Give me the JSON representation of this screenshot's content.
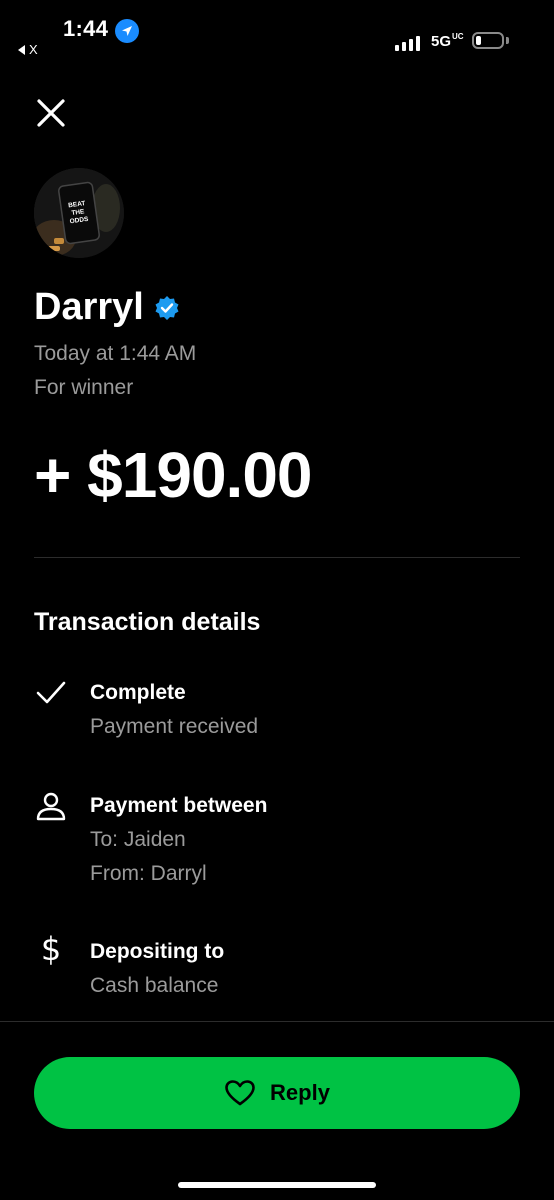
{
  "status_bar": {
    "time": "1:44",
    "back_app": "X",
    "network": "5G",
    "network_suffix": "UC",
    "location_icon": "location-arrow-icon",
    "battery_level": 0.2
  },
  "header": {
    "close_icon": "close-icon"
  },
  "profile": {
    "avatar_text": [
      "BEAT",
      "THE",
      "ODDS"
    ],
    "name": "Darryl",
    "verified_icon": "verified-badge-icon"
  },
  "payment": {
    "timestamp": "Today at 1:44 AM",
    "note": "For winner",
    "amount": "+ $190.00"
  },
  "details": {
    "title": "Transaction details",
    "items": [
      {
        "icon": "check-icon",
        "title": "Complete",
        "lines": [
          "Payment received"
        ]
      },
      {
        "icon": "person-icon",
        "title": "Payment between",
        "lines": [
          "To: Jaiden",
          "From: Darryl"
        ]
      },
      {
        "icon": "dollar-icon",
        "title": "Depositing to",
        "lines": [
          "Cash balance"
        ]
      }
    ]
  },
  "actions": {
    "reply_label": "Reply",
    "reply_icon": "heart-icon"
  },
  "colors": {
    "background": "#000000",
    "accent_green": "#00c244",
    "muted_text": "#9b9b9b",
    "verified_blue": "#1d9bf0"
  }
}
